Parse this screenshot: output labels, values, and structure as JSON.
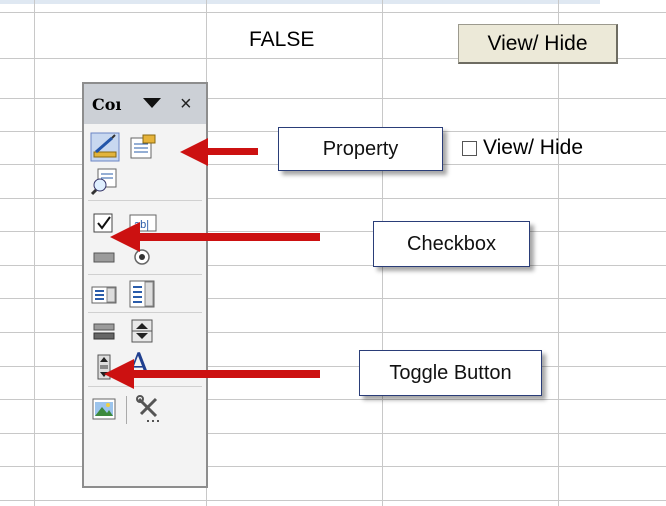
{
  "spreadsheet": {
    "cell_value": "FALSE",
    "button_label": "View/ Hide",
    "checkbox_label": "View/ Hide",
    "checkbox_checked": false
  },
  "toolbox": {
    "title": "Coı",
    "dropdown_icon": "triangle-down",
    "close_icon": "×",
    "tools": [
      {
        "name": "design-mode-icon",
        "icon": "ruler-pencil"
      },
      {
        "name": "properties-icon",
        "icon": "properties-sheet"
      },
      {
        "name": "view-code-icon",
        "icon": "magnifier-sheet"
      },
      {
        "name": "checkbox-tool-icon",
        "icon": "checkbox"
      },
      {
        "name": "textbox-tool-icon",
        "icon": "ab-textbox"
      },
      {
        "name": "command-button-tool-icon",
        "icon": "button"
      },
      {
        "name": "option-button-tool-icon",
        "icon": "radio"
      },
      {
        "name": "listbox-tool-icon",
        "icon": "list"
      },
      {
        "name": "combobox-tool-icon",
        "icon": "combo"
      },
      {
        "name": "toggle-button-tool-icon",
        "icon": "toggle"
      },
      {
        "name": "spin-button-tool-icon",
        "icon": "spin"
      },
      {
        "name": "scrollbar-tool-icon",
        "icon": "scroll"
      },
      {
        "name": "label-tool-icon",
        "icon": "A"
      },
      {
        "name": "image-tool-icon",
        "icon": "picture"
      },
      {
        "name": "more-controls-icon",
        "icon": "tools"
      }
    ],
    "label_glyph": "A"
  },
  "callouts": {
    "property": "Property",
    "checkbox": "Checkbox",
    "toggle": "Toggle Button"
  },
  "colors": {
    "arrow": "#cc1111",
    "grid": "#c8c8c8",
    "callout_border": "#2a3d78"
  }
}
